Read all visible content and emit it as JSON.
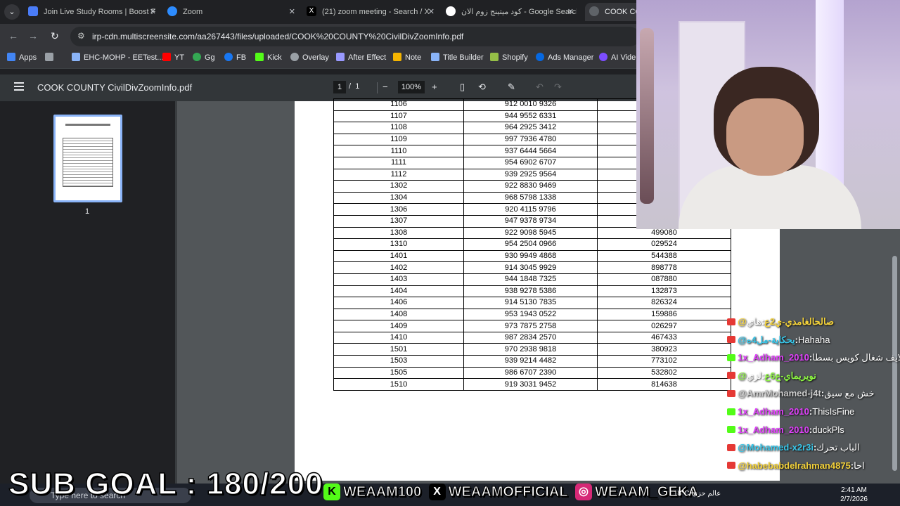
{
  "tabs": [
    {
      "title": "Join Live Study Rooms | Boost F",
      "icon": "study-icon",
      "color": "#4a7cf7"
    },
    {
      "title": "Zoom",
      "icon": "zoom-icon",
      "color": "#2d8cff"
    },
    {
      "title": "(21) zoom meeting - Search / X",
      "icon": "x-icon",
      "color": "#000000"
    },
    {
      "title": "كود ميتينج زوم الان - Google Search",
      "icon": "google-icon",
      "color": "#ffffff"
    },
    {
      "title": "COOK COU",
      "icon": "pdf-icon",
      "color": "#5f6368"
    }
  ],
  "address": {
    "url": "irp-cdn.multiscreensite.com/aa267443/files/uploaded/COOK%20COUNTY%20CivilDivZoomInfo.pdf"
  },
  "bookmarks": [
    {
      "label": "Apps",
      "color": "#4285f4"
    },
    {
      "label": "",
      "color": "#9aa0a6"
    },
    {
      "label": "EHC-MOHP - EETest...",
      "color": "#8ab4f8"
    },
    {
      "label": "YT",
      "color": "#ff0000"
    },
    {
      "label": "Gg",
      "color": "#34a853"
    },
    {
      "label": "FB",
      "color": "#1877f2"
    },
    {
      "label": "Kick",
      "color": "#53fc18"
    },
    {
      "label": "Overlay",
      "color": "#9aa0a6"
    },
    {
      "label": "After Effect",
      "color": "#9999ff"
    },
    {
      "label": "Note",
      "color": "#f4b400"
    },
    {
      "label": "Title Builder",
      "color": "#8ab4f8"
    },
    {
      "label": "Shopify",
      "color": "#95bf47"
    },
    {
      "label": "Ads Manager",
      "color": "#0668e1"
    },
    {
      "label": "AI Vide",
      "color": "#7c4dff"
    }
  ],
  "pdf": {
    "title": "COOK COUNTY CivilDivZoomInfo.pdf",
    "page_current": "1",
    "page_sep": "/",
    "page_total": "1",
    "zoom": "100%",
    "thumb_label": "1"
  },
  "table_rows": [
    [
      "1106",
      "912 0010 9326",
      ""
    ],
    [
      "1107",
      "944 9552 6331",
      ""
    ],
    [
      "1108",
      "964 2925 3412",
      ""
    ],
    [
      "1109",
      "997 7936 4780",
      ""
    ],
    [
      "1110",
      "937 6444 5664",
      ""
    ],
    [
      "1111",
      "954 6902 6707",
      ""
    ],
    [
      "1112",
      "939 2925 9564",
      ""
    ],
    [
      "1302",
      "922 8830 9469",
      ""
    ],
    [
      "1304",
      "968 5798 1338",
      ""
    ],
    [
      "1306",
      "920 4115 9796",
      ""
    ],
    [
      "1307",
      "947 9378 9734",
      ""
    ],
    [
      "1308",
      "922 9098 5945",
      "499080"
    ],
    [
      "1310",
      "954 2504 0966",
      "029524"
    ],
    [
      "1401",
      "930 9949 4868",
      "544388"
    ],
    [
      "1402",
      "914 3045 9929",
      "898778"
    ],
    [
      "1403",
      "944 1848 7325",
      "087880"
    ],
    [
      "1404",
      "938 9278 5386",
      "132873"
    ],
    [
      "1406",
      "914 5130 7835",
      "826324"
    ],
    [
      "1408",
      "953 1943 0522",
      "159886"
    ],
    [
      "1409",
      "973 7875 2758",
      "026297"
    ],
    [
      "1410",
      "987 2834 2570",
      "467433"
    ],
    [
      "1501",
      "970 2938 9818",
      "380923"
    ],
    [
      "1503",
      "939 9214 4482",
      "773102"
    ],
    [
      "1505",
      "986 6707 2390",
      "532802"
    ],
    [
      "1510",
      "919 3031 9452",
      "814638"
    ]
  ],
  "chat": [
    {
      "platform": "youtube",
      "user": "@صالحالغامدي-ي2ع",
      "user_color": "#f5d33b",
      "text": "هاي"
    },
    {
      "platform": "youtube",
      "user": "@يحكاية-مل4ه",
      "user_color": "#39c5e8",
      "text": "Hahaha"
    },
    {
      "platform": "kick",
      "user": "1x_Adham_2010",
      "user_color": "#e040fb",
      "text": "لايف شغال كويس بسطا"
    },
    {
      "platform": "youtube",
      "user": "@نويريماي-ع6ع",
      "user_color": "#8cf542",
      "text": "لزي"
    },
    {
      "platform": "youtube",
      "user": "@AmrMohamed-j4t",
      "user_color": "#cccccc",
      "text": "خش مع سيق"
    },
    {
      "platform": "kick",
      "user": "1x_Adham_2010",
      "user_color": "#e040fb",
      "text": "ThisIsFine"
    },
    {
      "platform": "kick",
      "user": "1x_Adham_2010",
      "user_color": "#e040fb",
      "text": "duckPls"
    },
    {
      "platform": "youtube",
      "user": "@Mohamed-x2r3i",
      "user_color": "#39c5e8",
      "text": "الباب تحرك"
    },
    {
      "platform": "youtube",
      "user": "@habebabdelrahman4875",
      "user_color": "#f5d33b",
      "text": "احا"
    }
  ],
  "overlay": {
    "sub_goal": "SUB GOAL : 180/200",
    "socials": [
      {
        "handle": "WEAAM100",
        "icon": "kick-icon",
        "color": "#53fc18",
        "glyph": "K"
      },
      {
        "handle": "WEAAMOFFICIAL",
        "icon": "x-icon",
        "color": "#000000",
        "glyph": "X"
      },
      {
        "handle": "WEAAM_GEKA",
        "icon": "instagram-icon",
        "color": "#d62976",
        "glyph": "◎"
      }
    ]
  },
  "taskbar": {
    "search_placeholder": "Type here to search",
    "weather": "18°C عالم حزنيا",
    "time": "2:41 AM",
    "date": "2/7/2026"
  }
}
